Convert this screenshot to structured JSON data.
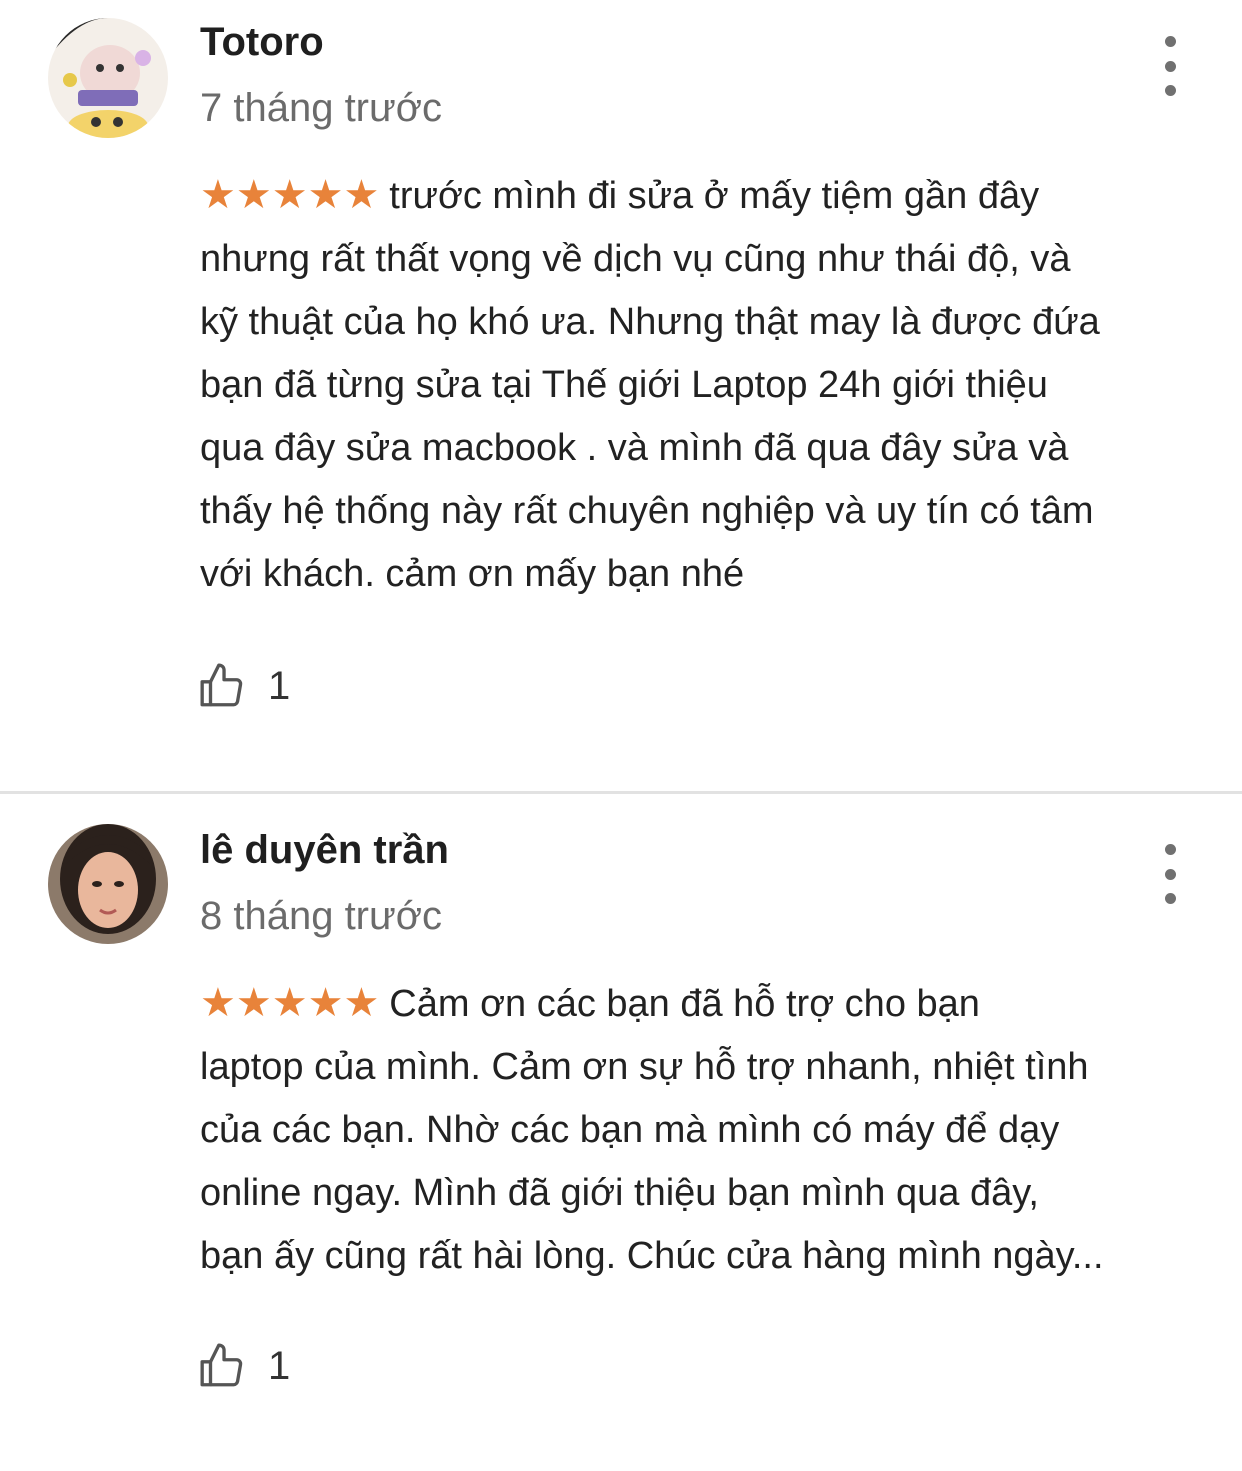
{
  "reviews": [
    {
      "author": "Totoro",
      "time": "7 tháng trước",
      "stars": "★★★★★",
      "rating": 5,
      "lines": [
        "trước mình đi sửa ở mấy tiệm gần đây",
        "nhưng rất thất vọng về dịch vụ cũng như thái độ, và",
        "kỹ thuật của họ khó ưa. Nhưng thật may là được đứa",
        "bạn đã từng sửa tại Thế giới Laptop 24h giới thiệu",
        "qua đây sửa macbook . và mình đã qua đây sửa và",
        "thấy hệ thống này rất chuyên nghiệp và uy tín có tâm",
        "với khách. cảm ơn mấy bạn nhé"
      ],
      "likes": "1"
    },
    {
      "author": "lê duyên trần",
      "time": "8 tháng trước",
      "stars": "★★★★★",
      "rating": 5,
      "lines": [
        "Cảm ơn các bạn đã hỗ trợ cho bạn",
        "laptop của mình. Cảm ơn sự hỗ trợ nhanh, nhiệt tình",
        "của các bạn. Nhờ các bạn mà mình có máy để dạy",
        "online ngay. Mình đã giới thiệu bạn mình qua đây,",
        "bạn ấy cũng rất hài lòng. Chúc cửa hàng mình ngày..."
      ],
      "likes": "1"
    }
  ],
  "colors": {
    "star": "#e8833a",
    "author": "#1f1f1f",
    "time": "#6b6b6b",
    "divider": "#e2e2e2"
  },
  "icons": {
    "more": "more-vert-icon",
    "like": "thumbs-up-icon"
  }
}
